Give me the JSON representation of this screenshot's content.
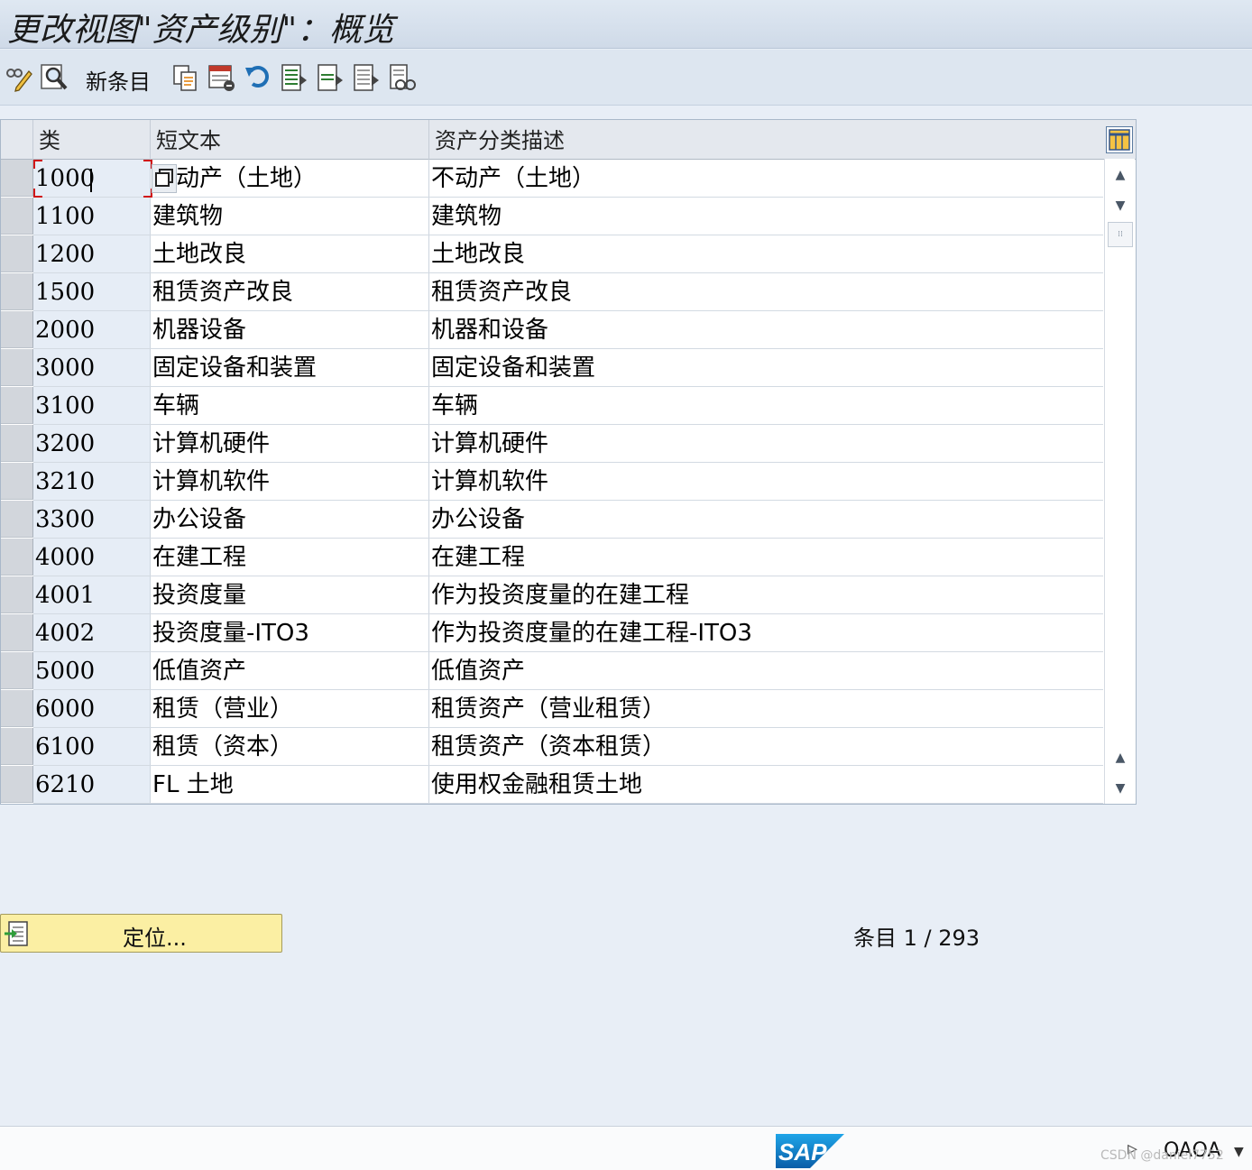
{
  "title": "更改视图\"资产级别\"：概览",
  "toolbar": {
    "new_entries_label": "新条目",
    "icons": [
      "display-change-icon",
      "find-icon",
      "copy-icon",
      "delete-icon",
      "undo-icon",
      "select-all-icon",
      "select-block-icon",
      "deselect-all-icon",
      "print-icon"
    ]
  },
  "table": {
    "headers": [
      "类",
      "短文本",
      "资产分类描述"
    ],
    "rows": [
      {
        "class": "1000",
        "short": "不动产（土地）",
        "desc": "不动产（土地）"
      },
      {
        "class": "1100",
        "short": "建筑物",
        "desc": "建筑物"
      },
      {
        "class": "1200",
        "short": "土地改良",
        "desc": "土地改良"
      },
      {
        "class": "1500",
        "short": "租赁资产改良",
        "desc": "租赁资产改良"
      },
      {
        "class": "2000",
        "short": "机器设备",
        "desc": "机器和设备"
      },
      {
        "class": "3000",
        "short": "固定设备和装置",
        "desc": "固定设备和装置"
      },
      {
        "class": "3100",
        "short": "车辆",
        "desc": "车辆"
      },
      {
        "class": "3200",
        "short": "计算机硬件",
        "desc": "计算机硬件"
      },
      {
        "class": "3210",
        "short": "计算机软件",
        "desc": "计算机软件"
      },
      {
        "class": "3300",
        "short": "办公设备",
        "desc": "办公设备"
      },
      {
        "class": "4000",
        "short": "在建工程",
        "desc": "在建工程"
      },
      {
        "class": "4001",
        "short": "投资度量",
        "desc": "作为投资度量的在建工程"
      },
      {
        "class": "4002",
        "short": "投资度量-ITO3",
        "desc": "作为投资度量的在建工程-ITO3"
      },
      {
        "class": "5000",
        "short": "低值资产",
        "desc": "低值资产"
      },
      {
        "class": "6000",
        "short": "租赁（营业）",
        "desc": "租赁资产（营业租赁）"
      },
      {
        "class": "6100",
        "short": "租赁（资本）",
        "desc": "租赁资产（资本租赁）"
      },
      {
        "class": "6210",
        "short": "FL 土地",
        "desc": "使用权金融租赁土地"
      }
    ]
  },
  "position_button_label": "定位...",
  "entries": {
    "label": "条目",
    "value": "1 / 293"
  },
  "status": {
    "tcode": "OAOA",
    "watermark": "CSDN @daniel7752"
  },
  "colors": {
    "accent": "#fbefa3",
    "background": "#e8eef6",
    "focus": "#d01818"
  }
}
